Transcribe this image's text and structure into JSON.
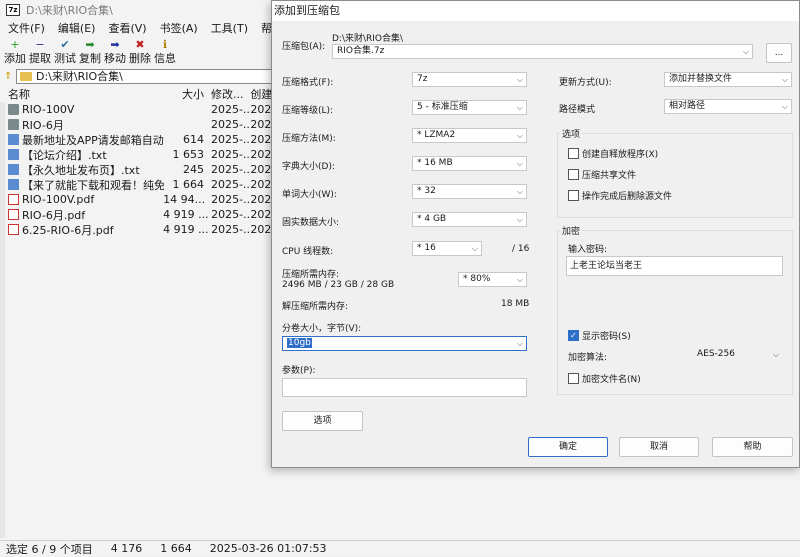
{
  "main": {
    "title": "D:\\来财\\RIO合集\\",
    "menu": [
      "文件(F)",
      "编辑(E)",
      "查看(V)",
      "书签(A)",
      "工具(T)",
      "帮助(H)"
    ],
    "toolbar": [
      {
        "label": "添加",
        "icon": "+",
        "color": "#2a9a2a"
      },
      {
        "label": "提取",
        "icon": "−",
        "color": "#2030a0"
      },
      {
        "label": "测试",
        "icon": "✔",
        "color": "#3070a0"
      },
      {
        "label": "复制",
        "icon": "➡",
        "color": "#2a8a2a"
      },
      {
        "label": "移动",
        "icon": "➡",
        "color": "#2030a0"
      },
      {
        "label": "删除",
        "icon": "✖",
        "color": "#c02020"
      },
      {
        "label": "信息",
        "icon": "ℹ",
        "color": "#b08000"
      }
    ],
    "address": "D:\\来财\\RIO合集\\",
    "columns": {
      "name": "名称",
      "size": "大小",
      "modified": "修改...",
      "created": "创建"
    },
    "files": [
      {
        "name": "RIO-100V",
        "size": "",
        "modified": "2025-...",
        "created": "202",
        "type": "folder"
      },
      {
        "name": "RIO-6月",
        "size": "",
        "modified": "2025-...",
        "created": "202",
        "type": "folder"
      },
      {
        "name": "最新地址及APP请发邮箱自动...",
        "size": "614",
        "modified": "2025-...",
        "created": "202",
        "type": "txt"
      },
      {
        "name": "【论坛介绍】.txt",
        "size": "1 653",
        "modified": "2025-...",
        "created": "202",
        "type": "txt"
      },
      {
        "name": "【永久地址发布页】.txt",
        "size": "245",
        "modified": "2025-...",
        "created": "202",
        "type": "txt"
      },
      {
        "name": "【来了就能下载和观看！纯免...",
        "size": "1 664",
        "modified": "2025-...",
        "created": "202",
        "type": "txt"
      },
      {
        "name": "RIO-100V.pdf",
        "size": "14 94...",
        "modified": "2025-...",
        "created": "202",
        "type": "pdf"
      },
      {
        "name": "RIO-6月.pdf",
        "size": "4 919 ...",
        "modified": "2025-...",
        "created": "202",
        "type": "pdf"
      },
      {
        "name": "6.25-RIO-6月.pdf",
        "size": "4 919 ...",
        "modified": "2025-...",
        "created": "202",
        "type": "pdf"
      }
    ],
    "status": {
      "selected": "选定 6 / 9 个项目",
      "total_size": "4 176",
      "sel_size": "1 664",
      "date": "2025-03-26 01:07:53"
    }
  },
  "dialog": {
    "title": "添加到压缩包",
    "archive_label": "压缩包(A):",
    "archive_path": "D:\\来财\\RIO合集\\",
    "archive_name": "RIO合集.7z",
    "browse_label": "...",
    "format_label": "压缩格式(F):",
    "format_value": "7z",
    "level_label": "压缩等级(L):",
    "level_value": "5 - 标准压缩",
    "method_label": "压缩方法(M):",
    "method_value": "* LZMA2",
    "dict_label": "字典大小(D):",
    "dict_value": "* 16 MB",
    "word_label": "单词大小(W):",
    "word_value": "* 32",
    "solid_label": "固实数据大小:",
    "solid_value": "* 4 GB",
    "cpu_label": "CPU 线程数:",
    "cpu_value": "* 16",
    "cpu_total": "/ 16",
    "mem_label": "压缩所需内存:",
    "mem_value": "2496 MB / 23 GB / 28 GB",
    "mem_pct": "* 80%",
    "decomp_label": "解压缩所需内存:",
    "decomp_value": "18 MB",
    "split_label": "分卷大小，字节(V):",
    "split_value": "10gb",
    "params_label": "参数(P):",
    "params_value": "",
    "options_button": "选项",
    "update_label": "更新方式(U):",
    "update_value": "添加并替换文件",
    "path_label": "路径模式",
    "path_value": "相对路径",
    "options_group": "选项",
    "opt_sfx": "创建自释放程序(X)",
    "opt_shared": "压缩共享文件",
    "opt_delete": "操作完成后删除源文件",
    "encrypt_group": "加密",
    "password_label": "输入密码:",
    "password_value": "上老王论坛当老王",
    "show_password": "显示密码(S)",
    "enc_method_label": "加密算法:",
    "enc_method_value": "AES-256",
    "enc_names": "加密文件名(N)",
    "ok": "确定",
    "cancel": "取消",
    "help": "帮助"
  }
}
